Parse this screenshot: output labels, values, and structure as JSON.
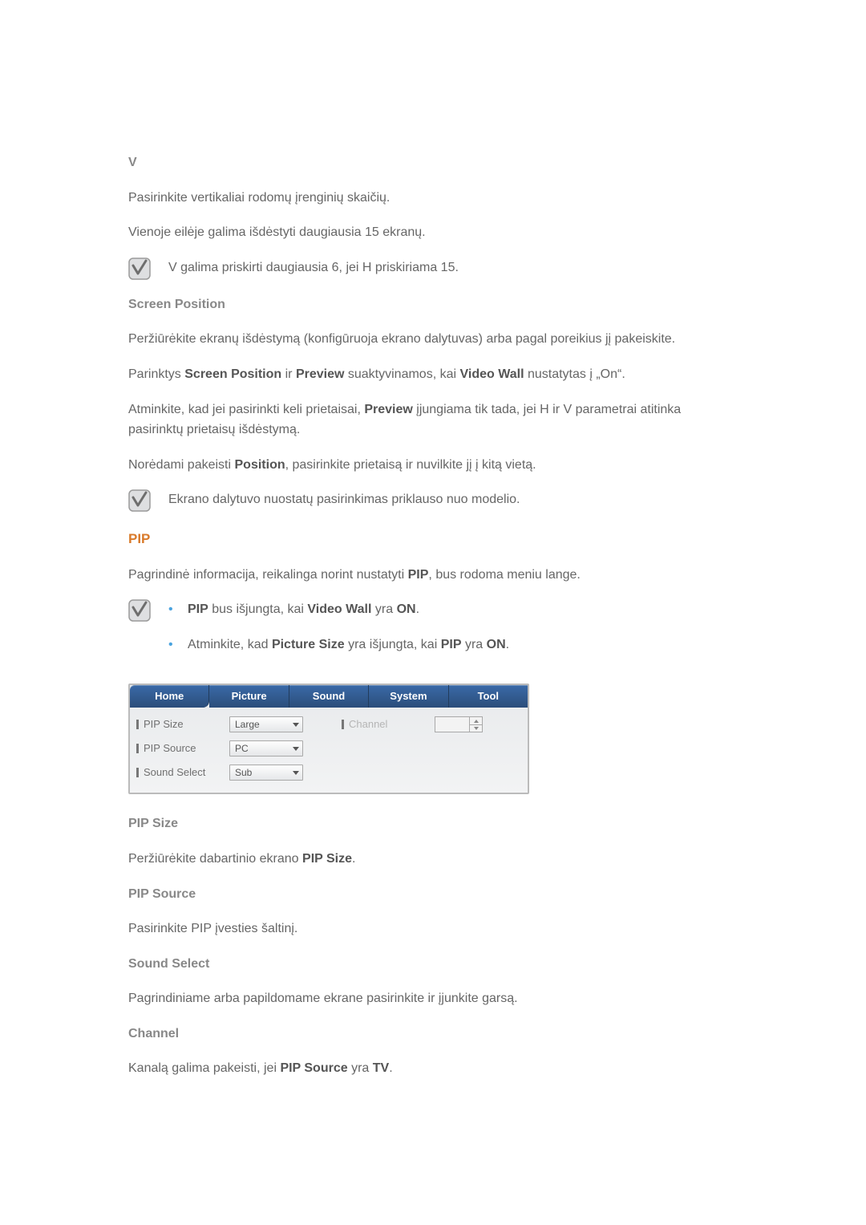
{
  "v": {
    "heading": "V",
    "p1": "Pasirinkite vertikaliai rodomų įrenginių skaičių.",
    "p2": "Vienoje eilėje galima išdėstyti daugiausia 15 ekranų.",
    "note": "V galima priskirti daugiausia 6, jei H priskiriama 15."
  },
  "screen_position": {
    "heading": "Screen Position",
    "p1": "Peržiūrėkite ekranų išdėstymą (konfigūruoja ekrano dalytuvas) arba pagal poreikius jį pakeiskite.",
    "p2_pre": "Parinktys ",
    "p2_b1": "Screen Position",
    "p2_mid1": " ir ",
    "p2_b2": "Preview",
    "p2_mid2": " suaktyvinamos, kai ",
    "p2_b3": "Video Wall",
    "p2_post": " nustatytas į „On“.",
    "p3_pre": "Atminkite, kad jei pasirinkti keli prietaisai, ",
    "p3_b": "Preview",
    "p3_post": " įjungiama tik tada, jei H ir V parametrai atitinka pasirinktų prietaisų išdėstymą.",
    "p4_pre": "Norėdami pakeisti ",
    "p4_b": "Position",
    "p4_post": ", pasirinkite prietaisą ir nuvilkite jį į kitą vietą.",
    "note": "Ekrano dalytuvo nuostatų pasirinkimas priklauso nuo modelio."
  },
  "pip": {
    "heading": "PIP",
    "p1_pre": "Pagrindinė informacija, reikalinga norint nustatyti ",
    "p1_b": "PIP",
    "p1_post": ", bus rodoma meniu lange.",
    "bullet1_b1": "PIP",
    "bullet1_mid1": " bus išjungta, kai ",
    "bullet1_b2": "Video Wall",
    "bullet1_mid2": " yra ",
    "bullet1_b3": "ON",
    "bullet1_post": ".",
    "bullet2_pre": "Atminkite, kad ",
    "bullet2_b1": "Picture Size",
    "bullet2_mid1": " yra išjungta, kai ",
    "bullet2_b2": "PIP",
    "bullet2_mid2": " yra ",
    "bullet2_b3": "ON",
    "bullet2_post": "."
  },
  "panel": {
    "tabs": {
      "home": "Home",
      "picture": "Picture",
      "sound": "Sound",
      "system": "System",
      "tool": "Tool"
    },
    "rows": {
      "pip_size": {
        "label": "PIP Size",
        "value": "Large"
      },
      "channel": {
        "label": "Channel",
        "value": ""
      },
      "pip_source": {
        "label": "PIP Source",
        "value": "PC"
      },
      "sound_select": {
        "label": "Sound Select",
        "value": "Sub"
      }
    }
  },
  "pip_size": {
    "heading": "PIP Size",
    "p_pre": "Peržiūrėkite dabartinio ekrano ",
    "p_b": "PIP Size",
    "p_post": "."
  },
  "pip_source": {
    "heading": "PIP Source",
    "p": "Pasirinkite PIP įvesties šaltinį."
  },
  "sound_select": {
    "heading": "Sound Select",
    "p": "Pagrindiniame arba papildomame ekrane pasirinkite ir įjunkite garsą."
  },
  "channel": {
    "heading": "Channel",
    "p_pre": "Kanalą galima pakeisti, jei ",
    "p_b1": "PIP Source",
    "p_mid": " yra ",
    "p_b2": "TV",
    "p_post": "."
  }
}
